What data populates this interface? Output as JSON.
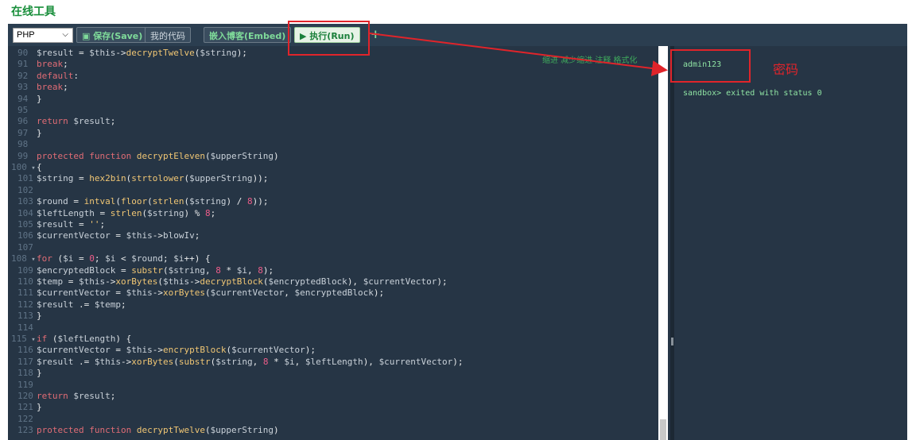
{
  "page": {
    "title": "在线工具"
  },
  "toolbar": {
    "language": "PHP",
    "save_label": "保存(Save)",
    "my_code_label": "我的代码",
    "embed_label": "嵌入博客(Embed)",
    "run_label": "执行(Run)",
    "add_label": "+"
  },
  "editor": {
    "hint": "缩进 减少缩进 注释 格式化",
    "lines": [
      {
        "n": "90",
        "t": "$result = $this->decryptTwelve($string);"
      },
      {
        "n": "91",
        "t": "break;"
      },
      {
        "n": "92",
        "t": "default:"
      },
      {
        "n": "93",
        "t": "break;"
      },
      {
        "n": "94",
        "t": "}"
      },
      {
        "n": "95",
        "t": ""
      },
      {
        "n": "96",
        "t": "return $result;"
      },
      {
        "n": "97",
        "t": "}"
      },
      {
        "n": "98",
        "t": ""
      },
      {
        "n": "99",
        "t": "protected function decryptEleven($upperString)"
      },
      {
        "n": "100",
        "t": "{"
      },
      {
        "n": "101",
        "t": "$string = hex2bin(strtolower($upperString));"
      },
      {
        "n": "102",
        "t": ""
      },
      {
        "n": "103",
        "t": "$round = intval(floor(strlen($string) / 8));"
      },
      {
        "n": "104",
        "t": "$leftLength = strlen($string) % 8;"
      },
      {
        "n": "105",
        "t": "$result = '';"
      },
      {
        "n": "106",
        "t": "$currentVector = $this->blowIv;"
      },
      {
        "n": "107",
        "t": ""
      },
      {
        "n": "108",
        "t": "for ($i = 0; $i < $round; $i++) {"
      },
      {
        "n": "109",
        "t": "$encryptedBlock = substr($string, 8 * $i, 8);"
      },
      {
        "n": "110",
        "t": "$temp = $this->xorBytes($this->decryptBlock($encryptedBlock), $currentVector);"
      },
      {
        "n": "111",
        "t": "$currentVector = $this->xorBytes($currentVector, $encryptedBlock);"
      },
      {
        "n": "112",
        "t": "$result .= $temp;"
      },
      {
        "n": "113",
        "t": "}"
      },
      {
        "n": "114",
        "t": ""
      },
      {
        "n": "115",
        "t": "if ($leftLength) {"
      },
      {
        "n": "116",
        "t": "$currentVector = $this->encryptBlock($currentVector);"
      },
      {
        "n": "117",
        "t": "$result .= $this->xorBytes(substr($string, 8 * $i, $leftLength), $currentVector);"
      },
      {
        "n": "118",
        "t": "}"
      },
      {
        "n": "119",
        "t": ""
      },
      {
        "n": "120",
        "t": "return $result;"
      },
      {
        "n": "121",
        "t": "}"
      },
      {
        "n": "122",
        "t": ""
      },
      {
        "n": "123",
        "t": "protected function decryptTwelve($upperString)"
      }
    ]
  },
  "output": {
    "result": "admin123",
    "status": "sandbox> exited with status 0"
  },
  "annotation": {
    "label": "密码",
    "color": "#e0242a"
  }
}
